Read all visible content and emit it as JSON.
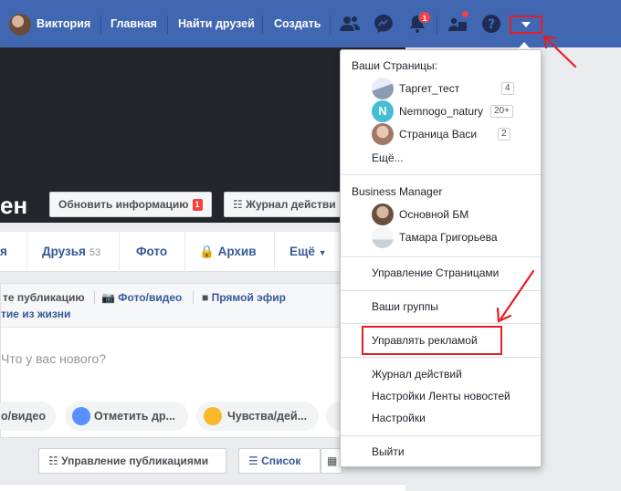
{
  "topbar": {
    "user_name": "Виктория",
    "nav": [
      "Главная",
      "Найти друзей",
      "Создать"
    ],
    "notifications_count": "1",
    "icons": [
      "friends-icon",
      "messenger-icon",
      "bell-icon",
      "people-icon",
      "help-icon",
      "chevron-down-icon"
    ]
  },
  "cover": {
    "name_fragment": "ен",
    "update_button": "Обновить информацию",
    "update_badge": "1",
    "activity_button": "Журнал действи"
  },
  "profile_tabs": {
    "frag": "я",
    "friends": "Друзья",
    "friends_count": "53",
    "photo": "Фото",
    "archive": "Архив",
    "more": "Ещё"
  },
  "composer": {
    "create_post": "те публикацию",
    "photo_video": "Фото/видео",
    "live": "Прямой эфир",
    "life_event": "тие из жизни",
    "placeholder": "Что у вас нового?",
    "pill_photo": "о/видео",
    "pill_tag": "Отметить др...",
    "pill_feeling": "Чувства/дей..."
  },
  "manage_row": {
    "manage_posts": "Управление публикациями",
    "list_view": "Список"
  },
  "menu": {
    "pages_header": "Ваши Страницы:",
    "pages": [
      {
        "label": "Таргет_тест",
        "count": "4"
      },
      {
        "label": "Nemnogo_natury",
        "count": "20+",
        "initial": "N"
      },
      {
        "label": "Страница Васи",
        "count": "2"
      }
    ],
    "more_pages": "Ещё...",
    "bm_header": "Business Manager",
    "bm_items": [
      "Основной БМ",
      "Тамара Григорьева"
    ],
    "items": {
      "manage_pages": "Управление Страницами",
      "your_groups": "Ваши группы",
      "manage_ads": "Управлять рекламой",
      "activity_log": "Журнал действий",
      "news_feed_settings": "Настройки Ленты новостей",
      "settings": "Настройки",
      "logout": "Выйти"
    }
  },
  "colors": {
    "fb_blue": "#4267b2",
    "link_blue": "#365899",
    "highlight_red": "#e41e26",
    "badge_red": "#fa3e3e"
  }
}
